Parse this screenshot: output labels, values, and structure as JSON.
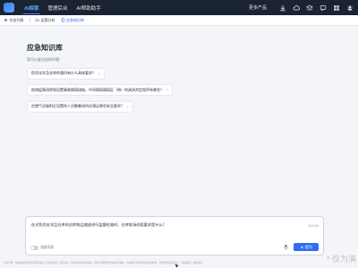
{
  "topbar": {
    "tabs": [
      "AI探索",
      "管理后台",
      "AI帮助助手"
    ],
    "more_products": "更多产品"
  },
  "subnav": {
    "items": [
      "任务列表",
      "运营分析",
      "应急知识库"
    ]
  },
  "main": {
    "title": "应急知识库",
    "subtitle": "您可以尝试这样问我：",
    "suggestions": [
      "危险化学品仓库的通风有什么具体要求？",
      "疾病疫情消除和设置事故隔离措施，中间隔离隔离区（带）的具体判定程序有哪些？",
      "在燃气设施附近设置的人员聚集场所应满足哪些安全要求？"
    ]
  },
  "composer": {
    "text": "在对危险化学品仓库的应库物品储放进行监督检查时，仓库堆场间距要求是什么？",
    "char_count": "36/150",
    "deep_think_label": "深度问答",
    "send_label": "提问"
  },
  "footer": {
    "text": "免责声明：本系统提供的所有回答均由人工智能生成，仅供参考。用户在使用本系统时，应自行判断回答内容的准确性。本系统不对回答内容的完整性、可靠性作任何保证。 | 联系我们 | 版权所有"
  },
  "watermark": "* 仅为演"
}
